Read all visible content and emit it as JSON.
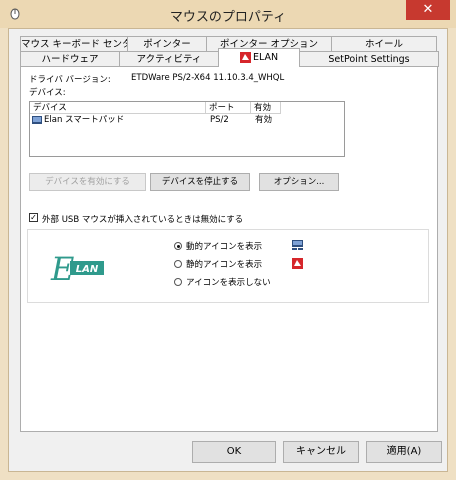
{
  "window": {
    "title": "マウスのプロパティ",
    "close_label": "✕"
  },
  "tabs_row1": [
    "マウス キーボード センター",
    "ポインター",
    "ポインター オプション",
    "ホイール"
  ],
  "tabs_row2": [
    "ハードウェア",
    "アクティビティ",
    "ELAN",
    "SetPoint Settings"
  ],
  "driver": {
    "label": "ドライバ バージョン:",
    "value": "ETDWare PS/2-X64 11.10.3.4_WHQL"
  },
  "devices_label": "デバイス:",
  "device_list": {
    "columns": [
      "デバイス",
      "ポート",
      "有効"
    ],
    "rows": [
      {
        "name": "Elan スマートパッド",
        "port": "PS/2",
        "enabled": "有効"
      }
    ]
  },
  "buttons": {
    "enable": "デバイスを有効にする",
    "disable": "デバイスを停止する",
    "options": "オプション..."
  },
  "checkbox": {
    "label": "外部 USB マウスが挿入されているときは無効にする",
    "checked": true
  },
  "logo_text": "LAN",
  "radios": [
    {
      "label": "動的アイコンを表示",
      "selected": true
    },
    {
      "label": "静的アイコンを表示",
      "selected": false
    },
    {
      "label": "アイコンを表示しない",
      "selected": false
    }
  ],
  "footer": {
    "ok": "OK",
    "cancel": "キャンセル",
    "apply": "適用(A)"
  }
}
